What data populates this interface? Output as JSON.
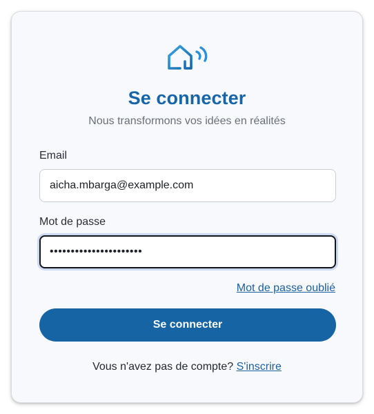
{
  "brand": {
    "logo_icon": "smart-home-icon",
    "accent_color": "#1565a8"
  },
  "login": {
    "title": "Se connecter",
    "subtitle": "Nous transformons vos idées en réalités",
    "email_label": "Email",
    "email_value": "aicha.mbarga@example.com",
    "password_label": "Mot de passe",
    "password_value": "••••••••••••••••••••••",
    "forgot_link": "Mot de passe oublié",
    "submit_label": "Se connecter",
    "no_account_text": "Vous n'avez pas de compte?",
    "signup_link": "S'inscrire"
  }
}
